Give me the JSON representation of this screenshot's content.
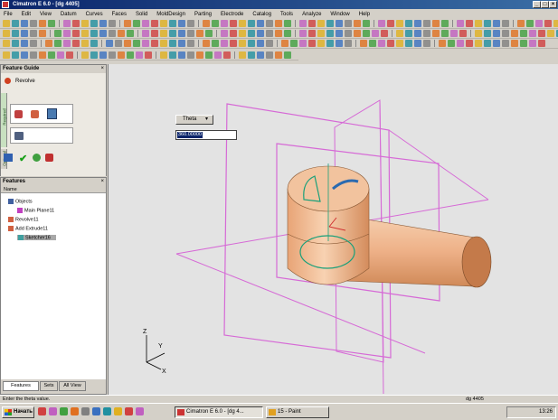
{
  "window": {
    "title": "Cimatron E 6.0 - [dg 4405]",
    "min": "_",
    "max": "□",
    "close": "×"
  },
  "menu": [
    "File",
    "Edit",
    "View",
    "Datum",
    "Curves",
    "Faces",
    "Solid",
    "MoldDesign",
    "Parting",
    "Electrode",
    "Catalog",
    "Tools",
    "Analyze",
    "Window",
    "Help"
  ],
  "feature_guide": {
    "title": "Feature Guide",
    "close": "×",
    "step": "Revolve",
    "tab_required": "Required",
    "tab_optional": "Optional"
  },
  "features_panel": {
    "title": "Features",
    "close": "×",
    "col_name": "Name",
    "items": [
      {
        "label": "Objects",
        "indent": 0,
        "selected": false
      },
      {
        "label": "Main Plane11",
        "indent": 1,
        "selected": false
      },
      {
        "label": "Revolve11",
        "indent": 0,
        "selected": false
      },
      {
        "label": "Add Extrude11",
        "indent": 0,
        "selected": false
      },
      {
        "label": "Sketcher16",
        "indent": 1,
        "selected": true
      }
    ],
    "tabs": [
      "Features",
      "Sets",
      "All View"
    ]
  },
  "theta": {
    "label": "Theta",
    "value": "360.00000"
  },
  "status": {
    "prompt": "Enter the theta value.",
    "file": "dg 4405"
  },
  "taskbar": {
    "start": "Начать",
    "tasks": [
      "Cimatron E 6.0 - [dg 4...",
      "15 - Paint"
    ],
    "clock": "13:26"
  },
  "axes": {
    "z": "Z",
    "y": "Y",
    "x": "X"
  },
  "colors": {
    "plane": "#d66ad6",
    "solid": "#f0b890",
    "solid_dark": "#b8784a",
    "sketch": "#1aa07a"
  }
}
